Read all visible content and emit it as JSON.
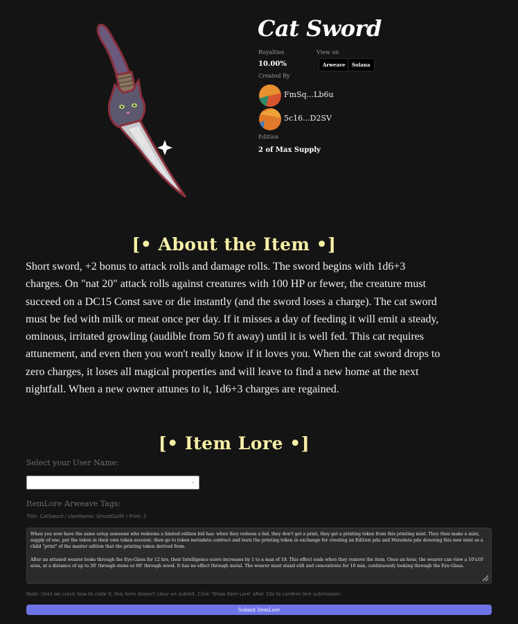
{
  "item": {
    "title": "Cat Sword",
    "royalties_label": "Royalties",
    "royalties_value": "10.00%",
    "view_on_label": "View on",
    "view_on_buttons": [
      "Arweave",
      "Solana"
    ],
    "created_by_label": "Created By",
    "creators": [
      {
        "name": "FmSq...Lb6u",
        "avatar_colors": [
          "#d9552f",
          "#e8902f",
          "#2f8a6a"
        ]
      },
      {
        "name": "5c16...D2SV",
        "avatar_colors": [
          "#e07a2a",
          "#f0a33a",
          "#3b7dbf"
        ]
      }
    ],
    "edition_label": "Edition",
    "edition_value": "2 of Max Supply",
    "image_icon": "cat-sword-icon"
  },
  "about": {
    "heading": "[• About the Item •]",
    "description": "Short sword, +2 bonus to attack rolls and damage rolls. The sword begins with 1d6+3 charges. On \"nat 20\" attack rolls against creatures with 100 HP or fewer, the creature must succeed on a DC15 Const save or die instantly (and the sword loses a charge). The cat sword must be fed with milk or meat once per day. If it misses a day of feeding it will emit a steady, ominous, irritated growling (audible from 50 ft away) until it is well fed. This cat requires attunement, and even then you won't really know if it loves you. When the cat sword drops to zero charges, it loses all magical properties and will leave to find a new home at the next nightfall. When a new owner attunes to it, 1d6+3 charges are regained."
  },
  "lore": {
    "heading": "[• Item Lore •]",
    "username_label": "Select your User Name:",
    "username_value": "",
    "tags_label": "ItemLore Arweave Tags:",
    "tags_value": "Title: CatSword / UserName: GhostOutfit / Print: 2",
    "textarea_paragraphs": [
      "When you now have the same setup someone who redeems a limited edition bid has: when they redeem a bid, they don't get a print, they get a printing token from this printing mint. They then make a mint, supply of one, put the token in their own token account, then go to token metadata contract and burn the printing token in exchange for creating an Edition pda and Metadata pda denoting this new mint as a child \"print\" of the master edition that the printing token derived from.",
      "After an attuned wearer looks through the Eye-Glass for 12 hrs, their Intelligence score increases by 1 to a max of 19. This effect ends when they remove the item. Once an hour, the wearer can view a 10'x10' area, at a distance of up to 30' through stone or 60' through wood. It has no effect through metal. The wearer must stand still and concentrate for 10 min, continuously looking through the Eye-Glass."
    ],
    "note": "Note: Until we crack how to code it, this form doesn't clear on submit. Click 'Show Item Lore' after 10s to confirm lore submission.",
    "submit_label": "Submit ItemLore"
  },
  "colors": {
    "background": "#141414",
    "heading_yellow": "#f6f0a6",
    "submit_button": "#6e74e6"
  }
}
